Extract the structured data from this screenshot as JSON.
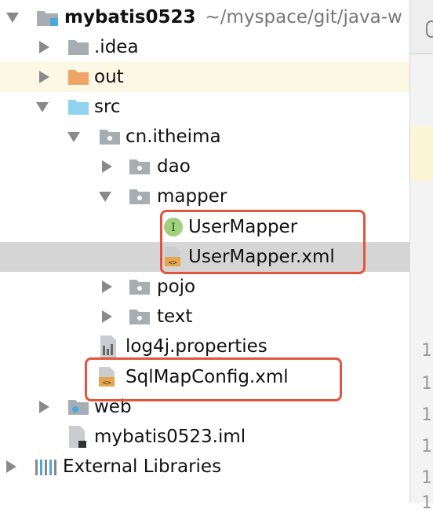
{
  "tree": {
    "rows": [
      {
        "label": "mybatis0523",
        "path": "~/myspace/git/java-w",
        "bold": true
      },
      {
        "label": ".idea"
      },
      {
        "label": "out"
      },
      {
        "label": "src"
      },
      {
        "label": "cn.itheima"
      },
      {
        "label": "dao"
      },
      {
        "label": "mapper"
      },
      {
        "label": "UserMapper"
      },
      {
        "label": "UserMapper.xml"
      },
      {
        "label": "pojo"
      },
      {
        "label": "text"
      },
      {
        "label": "log4j.properties"
      },
      {
        "label": "SqlMapConfig.xml"
      },
      {
        "label": "web"
      },
      {
        "label": "mybatis0523.iml"
      },
      {
        "label": "External Libraries"
      }
    ]
  },
  "editor_gutter": {
    "numbers": [
      "1",
      "1",
      "1",
      "1",
      "1",
      "1"
    ]
  },
  "colors": {
    "highlight_box": "#e2553c",
    "selected_row": "#d5d5d5",
    "out_row": "#fcf8e3"
  }
}
